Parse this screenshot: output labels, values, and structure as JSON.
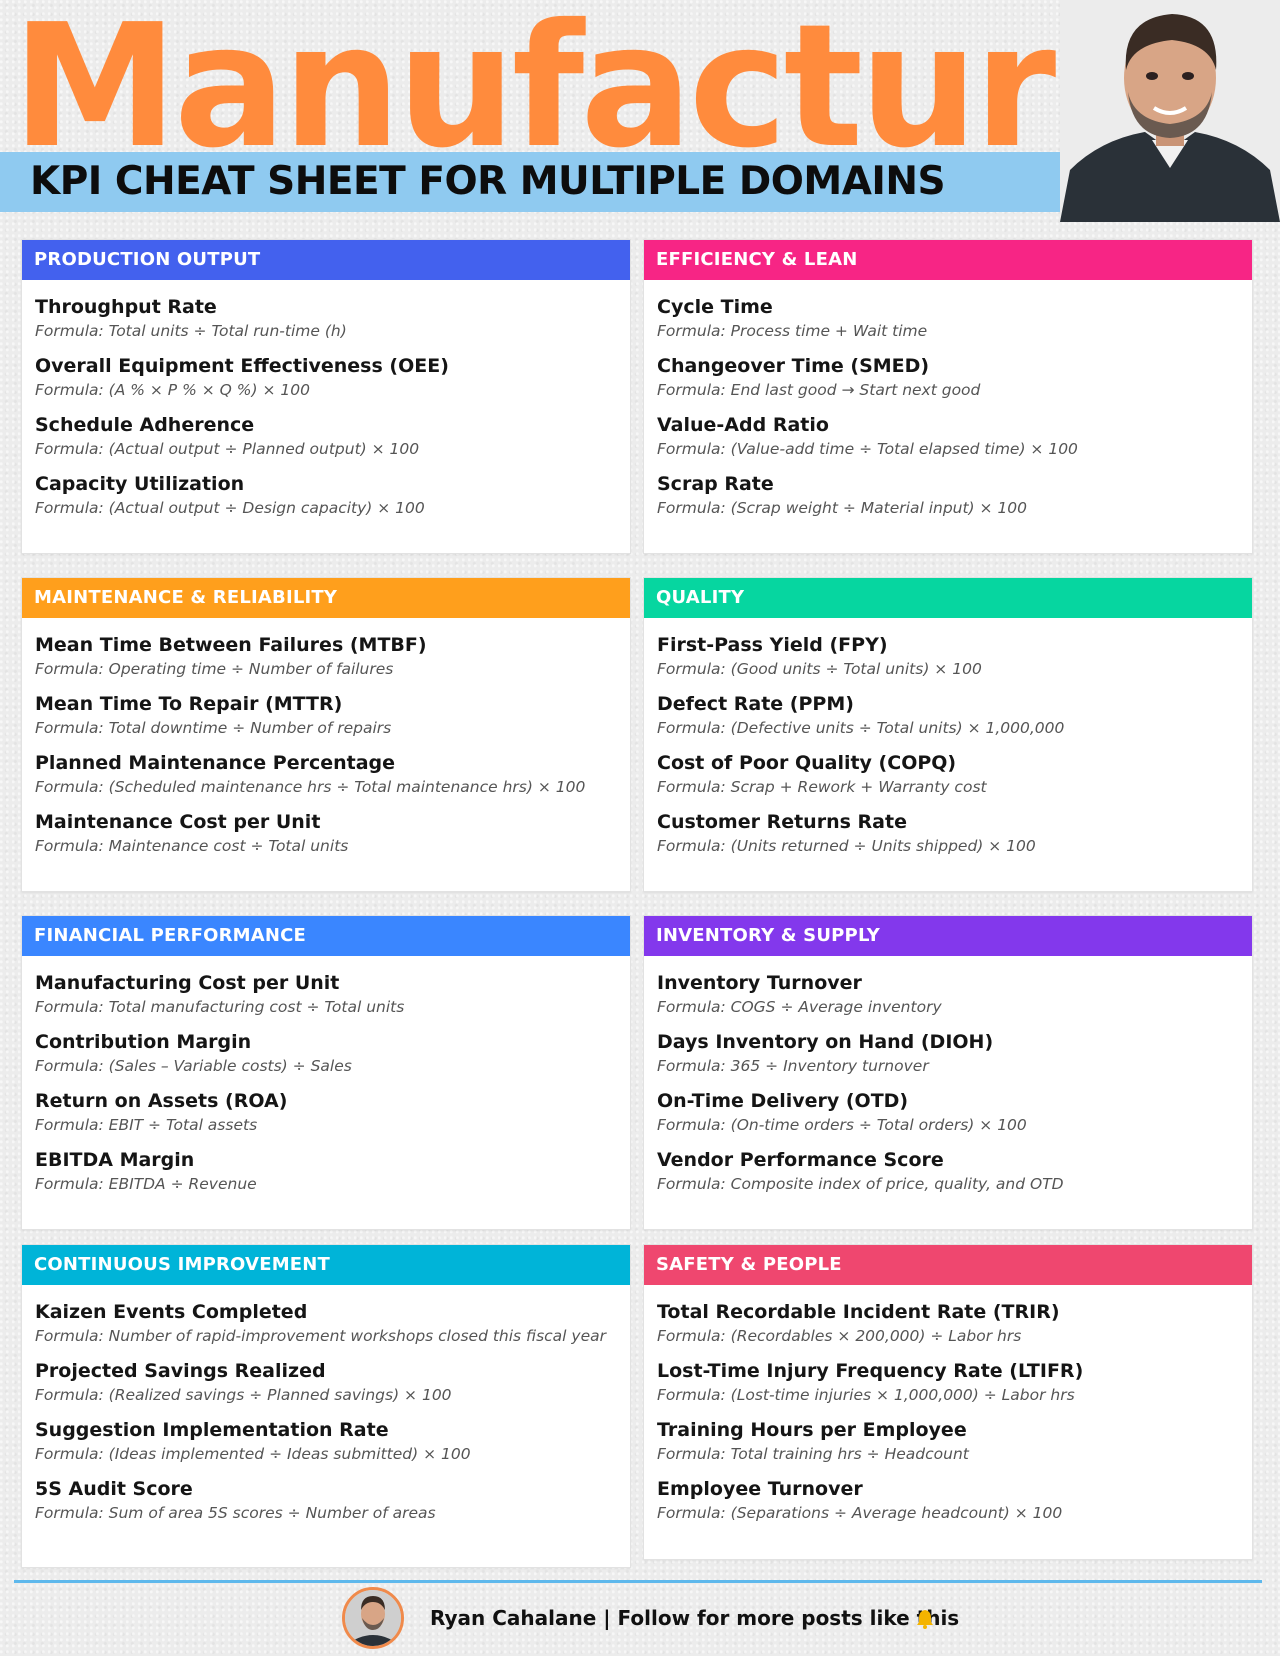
{
  "header": {
    "title": "Manufacturing",
    "subtitle": "KPI CHEAT SHEET FOR MULTIPLE DOMAINS",
    "title_color": "#ff8b3d",
    "band_color": "#8fcaf0"
  },
  "sections": [
    {
      "heading": "PRODUCTION OUTPUT",
      "color": "#4361ee",
      "kpis": [
        {
          "name": "Throughput Rate",
          "formula": "Formula: Total units ÷ Total run-time (h)"
        },
        {
          "name": "Overall Equipment Effectiveness (OEE)",
          "formula": "Formula: (A % × P % × Q %) × 100"
        },
        {
          "name": "Schedule Adherence",
          "formula": "Formula: (Actual output ÷ Planned output) × 100"
        },
        {
          "name": "Capacity Utilization",
          "formula": "Formula: (Actual output ÷ Design capacity) × 100"
        }
      ]
    },
    {
      "heading": "EFFICIENCY & LEAN",
      "color": "#f72585",
      "kpis": [
        {
          "name": "Cycle Time",
          "formula": "Formula: Process time + Wait time"
        },
        {
          "name": "Changeover Time (SMED)",
          "formula": "Formula: End last good → Start next good"
        },
        {
          "name": "Value-Add Ratio",
          "formula": "Formula: (Value-add time ÷ Total elapsed time) × 100"
        },
        {
          "name": "Scrap Rate",
          "formula": "Formula: (Scrap weight ÷ Material input) × 100"
        }
      ]
    },
    {
      "heading": "MAINTENANCE & RELIABILITY",
      "color": "#ff9f1c",
      "kpis": [
        {
          "name": "Mean Time Between Failures (MTBF)",
          "formula": "Formula: Operating time ÷ Number of failures"
        },
        {
          "name": "Mean Time To Repair (MTTR)",
          "formula": "Formula: Total downtime ÷ Number of repairs"
        },
        {
          "name": "Planned Maintenance Percentage",
          "formula": "Formula: (Scheduled maintenance hrs ÷ Total maintenance hrs) × 100"
        },
        {
          "name": "Maintenance Cost per Unit",
          "formula": "Formula: Maintenance cost ÷ Total units"
        }
      ]
    },
    {
      "heading": "QUALITY",
      "color": "#06d6a0",
      "kpis": [
        {
          "name": "First-Pass Yield (FPY)",
          "formula": "Formula: (Good units ÷ Total units) × 100"
        },
        {
          "name": "Defect Rate (PPM)",
          "formula": "Formula: (Defective units ÷ Total units) × 1,000,000"
        },
        {
          "name": "Cost of Poor Quality (COPQ)",
          "formula": "Formula: Scrap + Rework + Warranty cost"
        },
        {
          "name": "Customer Returns Rate",
          "formula": "Formula: (Units returned ÷ Units shipped) × 100"
        }
      ]
    },
    {
      "heading": "FINANCIAL PERFORMANCE",
      "color": "#3a86ff",
      "kpis": [
        {
          "name": "Manufacturing Cost per Unit",
          "formula": "Formula: Total manufacturing cost ÷ Total units"
        },
        {
          "name": "Contribution Margin",
          "formula": "Formula: (Sales – Variable costs) ÷ Sales"
        },
        {
          "name": "Return on Assets (ROA)",
          "formula": "Formula: EBIT ÷ Total assets"
        },
        {
          "name": "EBITDA Margin",
          "formula": "Formula: EBITDA ÷ Revenue"
        }
      ]
    },
    {
      "heading": "INVENTORY & SUPPLY",
      "color": "#8338ec",
      "kpis": [
        {
          "name": "Inventory Turnover",
          "formula": "Formula: COGS ÷ Average inventory"
        },
        {
          "name": "Days Inventory on Hand (DIOH)",
          "formula": "Formula: 365 ÷ Inventory turnover"
        },
        {
          "name": "On-Time Delivery (OTD)",
          "formula": "Formula: (On-time orders ÷ Total orders) × 100"
        },
        {
          "name": "Vendor Performance Score",
          "formula": "Formula: Composite index of price, quality, and OTD"
        }
      ]
    },
    {
      "heading": "CONTINUOUS IMPROVEMENT",
      "color": "#00b4d8",
      "kpis": [
        {
          "name": "Kaizen Events Completed",
          "formula": "Formula: Number of rapid-improvement workshops closed this fiscal year"
        },
        {
          "name": "Projected Savings Realized",
          "formula": "Formula: (Realized savings ÷ Planned savings) × 100"
        },
        {
          "name": "Suggestion Implementation Rate",
          "formula": "Formula: (Ideas implemented ÷ Ideas submitted) × 100"
        },
        {
          "name": "5S Audit Score",
          "formula": "Formula: Sum of area 5S scores ÷ Number of areas"
        }
      ]
    },
    {
      "heading": "SAFETY & PEOPLE",
      "color": "#ef476f",
      "kpis": [
        {
          "name": "Total Recordable Incident Rate (TRIR)",
          "formula": "Formula: (Recordables × 200,000) ÷ Labor hrs"
        },
        {
          "name": "Lost-Time Injury Frequency Rate (LTIFR)",
          "formula": "Formula: (Lost-time injuries × 1,000,000) ÷ Labor hrs"
        },
        {
          "name": "Training Hours per Employee",
          "formula": "Formula: Total training hrs ÷ Headcount"
        },
        {
          "name": "Employee Turnover",
          "formula": "Formula: (Separations ÷ Average headcount) × 100"
        }
      ]
    }
  ],
  "footer": {
    "text": "Ryan Cahalane | Follow for more posts like this",
    "bell_icon": "bell-icon",
    "line_color": "#5eb8ec"
  }
}
